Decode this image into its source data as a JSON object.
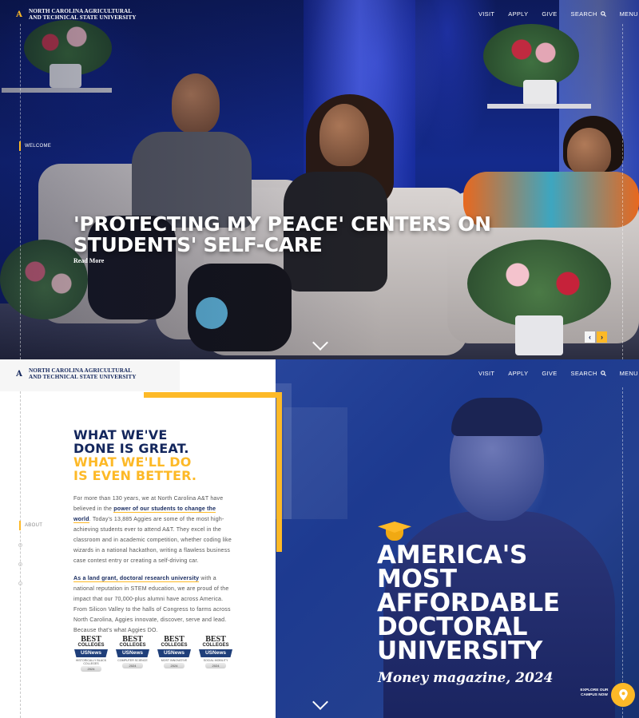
{
  "hero": {
    "logo": {
      "line1": "North Carolina Agricultural",
      "line2": "and Technical State University"
    },
    "nav": {
      "visit": "VISIT",
      "apply": "APPLY",
      "give": "GIVE",
      "search": "SEARCH",
      "menu": "MENU"
    },
    "section_label": "WELCOME",
    "headline": "'PROTECTING MY PEACE' CENTERS ON STUDENTS' SELF-CARE",
    "read_more": "Read More",
    "prev_arrow": "‹",
    "next_arrow": "›"
  },
  "about": {
    "logo": {
      "line1": "North Carolina Agricultural",
      "line2": "and Technical State University"
    },
    "nav": {
      "visit": "VISIT",
      "apply": "APPLY",
      "give": "GIVE",
      "search": "SEARCH",
      "menu": "MENU"
    },
    "section_label": "ABOUT",
    "heading_line1": "WHAT WE'VE",
    "heading_line2": "DONE IS GREAT.",
    "heading_line3": "WHAT WE'LL DO",
    "heading_line4": "IS EVEN BETTER.",
    "p1_a": "For more than 130 years, we at North Carolina A&T have believed in the ",
    "p1_link": "power of our students to change the world",
    "p1_b": ". Today's 13,885 Aggies are some of the most high-achieving students ever to attend A&T. They excel in the classroom and in academic competition, whether coding like wizards in a national hackathon, writing a flawless business case contest entry or creating a self-driving car.",
    "p2_link": "As a land grant, doctoral research university",
    "p2_b": " with a national reputation in STEM education, we are proud of the impact that our 70,000-plus alumni have across America. From Silicon Valley to the halls of Congress to farms across North Carolina, Aggies innovate, discover, serve and lead. Because that's what Aggies DO.",
    "badges": [
      {
        "top": "BEST",
        "mid": "COLLEGES",
        "brand": "USNews",
        "caption": "HISTORICALLY BLACK COLLEGES",
        "year": "2024"
      },
      {
        "top": "BEST",
        "mid": "COLLEGES",
        "brand": "USNews",
        "caption": "COMPUTER SCIENCE",
        "year": "2024"
      },
      {
        "top": "BEST",
        "mid": "COLLEGES",
        "brand": "USNews",
        "caption": "MOST INNOVATIVE",
        "year": "2024"
      },
      {
        "top": "BEST",
        "mid": "COLLEGES",
        "brand": "USNews",
        "caption": "SOCIAL MOBILITY",
        "year": "2024"
      }
    ],
    "feature_line1": "AMERICA'S",
    "feature_line2": "MOST",
    "feature_line3": "AFFORDABLE",
    "feature_line4": "DOCTORAL",
    "feature_line5": "UNIVERSITY",
    "feature_source": "Money magazine, 2024",
    "explore": "EXPLORE OUR CAMPUS NOW"
  },
  "colors": {
    "navy": "#13265c",
    "gold": "#fdb927",
    "white": "#ffffff"
  },
  "icons": {
    "search": "search-icon",
    "menu": "hamburger-icon",
    "chevron": "chevron-down-icon",
    "cap": "graduation-cap-icon",
    "pin": "location-pin-icon"
  }
}
